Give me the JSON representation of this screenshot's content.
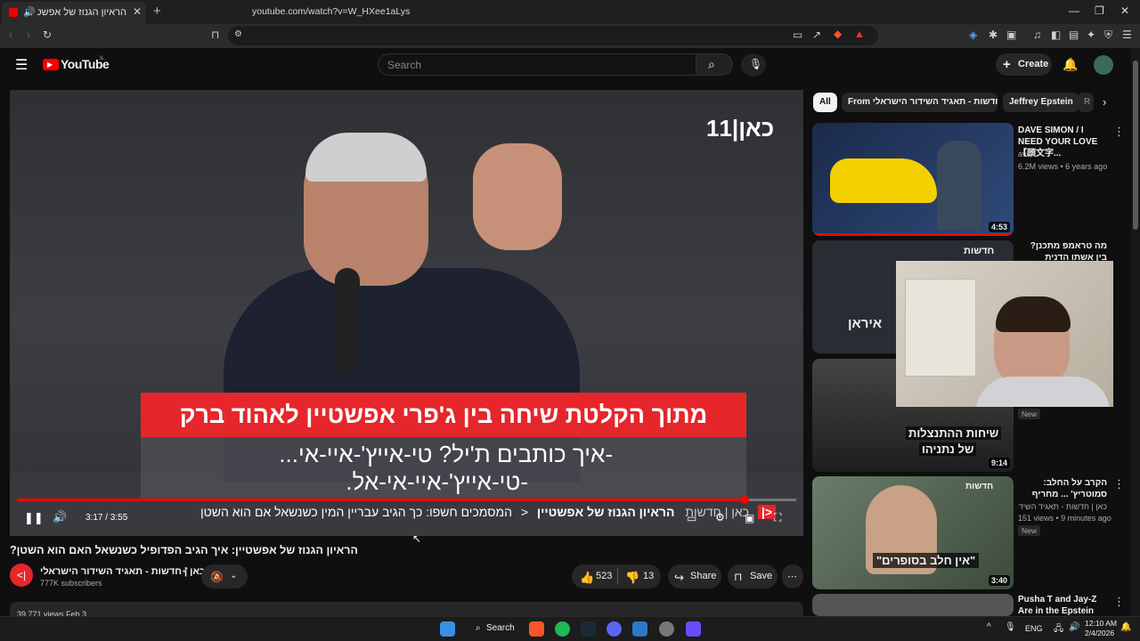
{
  "browser": {
    "tab_title": "הראיון הגנוז של אפשטיין: איך",
    "url": "youtube.com/watch?v=W_HXee1aLys",
    "new_tab": "+",
    "window": {
      "minimize": "—",
      "restore": "❐",
      "close": "✕"
    }
  },
  "youtube": {
    "logo_text": "YouTube",
    "logo_region": "IL",
    "search_placeholder": "Search",
    "create_label": "Create"
  },
  "video": {
    "channel_logo": "כאן|11",
    "banner_text": "מתוך הקלטת שיחה בין ג'פרי אפשטיין לאהוד ברק",
    "subtitle_line1": "-איך כותבים ת'יל? טי-אייץ'-איי-אי...",
    "subtitle_line2": "-טי-אייץ'-איי-אי-אל.",
    "ticker_brand": "כאן | חדשות",
    "ticker_title": "הראיון הגנוז של אפשטיין",
    "ticker_text": "המסמכים חשפו: כך הגיב עבריין המין כשנשאל אם הוא השטן",
    "time": "3:17 / 3:55",
    "progress": 0.934,
    "title": "הראיון הגנוז של אפשטיין: איך הגיב הפדופיל כשנשאל האם הוא השטן?",
    "channel_name": "כאן | חדשות - תאגיד השידור הישראלי",
    "subscribers": "777K subscribers",
    "likes": "523",
    "dislikes": "13",
    "share_label": "Share",
    "save_label": "Save",
    "description_stub": "39,771 views  Feb 3"
  },
  "chips": [
    {
      "label": "All"
    },
    {
      "label": "From כאן | חדשות - תאגיד השידור הישראלי"
    },
    {
      "label": "Jeffrey Epstein"
    },
    {
      "label": "R"
    }
  ],
  "recommendations": [
    {
      "title": "DAVE SIMON / I NEED YOUR LOVE【頭文字...",
      "channel": "avex",
      "meta": "6.2M views • 6 years ago",
      "duration": "4:53",
      "badge": ""
    },
    {
      "title": "מה טראמפ מתכנן? בין אשתו הדנית לפתרון...",
      "channel": "",
      "meta": "",
      "duration": "",
      "badge": "",
      "thumb_text": "חדשות",
      "thumb_text2": "איראן"
    },
    {
      "title": "",
      "channel": "",
      "meta": "",
      "duration": "9:14",
      "badge": "New",
      "thumb_text": "שיחות ההתנצלות",
      "thumb_text2": "של נתניהו"
    },
    {
      "title": "הקרב על החלב: סמוטריץ' ... מחריף את העצירים נגד",
      "channel": "כאן | חדשות - תאגיד השידור הישרא...",
      "meta": "151 views • 9 minutes ago",
      "duration": "3:40",
      "badge": "New",
      "thumb_text": "חדשות",
      "thumb_text2": "\"אין חלב בסופרים\""
    },
    {
      "title": "Pusha T and Jay-Z Are in the Epstein Files",
      "channel": "",
      "meta": "",
      "duration": "",
      "badge": ""
    }
  ],
  "taskbar": {
    "search_label": "Search",
    "lang": "ENG",
    "time": "12:10 AM",
    "date": "2/4/2026"
  },
  "colors": {
    "accent_red": "#ff0000",
    "kan_red": "#e5262b",
    "background": "#0f0f0f"
  }
}
